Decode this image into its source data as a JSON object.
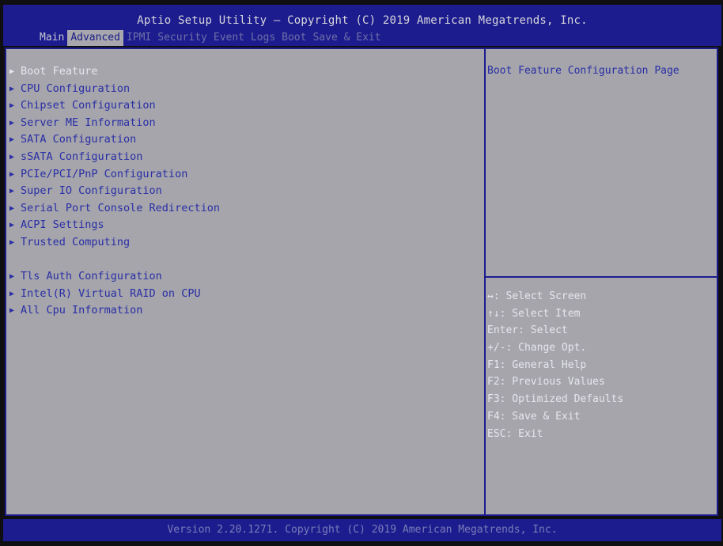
{
  "header": {
    "title": "Aptio Setup Utility – Copyright (C) 2019 American Megatrends, Inc.",
    "tabs": [
      "Main",
      "Advanced",
      "IPMI",
      "Security",
      "Event Logs",
      "Boot",
      "Save & Exit"
    ],
    "active_tab": "Advanced"
  },
  "menu": {
    "items": [
      "Boot Feature",
      "CPU Configuration",
      "Chipset Configuration",
      "Server ME Information",
      "SATA Configuration",
      "sSATA Configuration",
      "PCIe/PCI/PnP Configuration",
      "Super IO Configuration",
      "Serial Port Console Redirection",
      "ACPI Settings",
      "Trusted Computing",
      "Tls Auth Configuration",
      "Intel(R) Virtual RAID on CPU",
      "All Cpu Information"
    ],
    "selected": "Boot Feature",
    "arrow_icon": "right-triangle-icon"
  },
  "help": {
    "description": "Boot Feature Configuration Page",
    "keys": [
      "↔: Select Screen",
      "↑↓: Select Item",
      "Enter: Select",
      "+/-: Change Opt.",
      "F1: General Help",
      "F2: Previous Values",
      "F3: Optimized Defaults",
      "F4: Save & Exit",
      "ESC: Exit"
    ]
  },
  "footer": {
    "text": "Version 2.20.1271. Copyright (C) 2019 American Megatrends, Inc."
  },
  "colors": {
    "bar_blue": "#1d1c8e",
    "panel_gray": "#a5a5ab",
    "item_blue": "#2a2ea6",
    "highlight_white": "#e6e6ee"
  }
}
